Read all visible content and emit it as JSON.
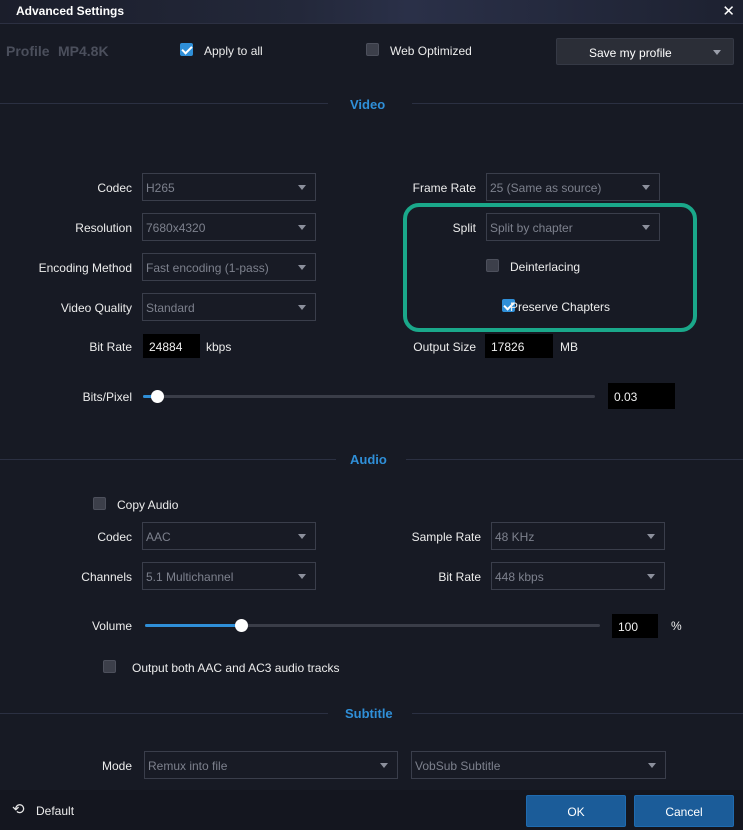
{
  "window": {
    "title": "Advanced Settings",
    "close_icon": "close-icon"
  },
  "profile": {
    "prefix": "Profile",
    "name": "MP4.8K",
    "apply_to_all": {
      "label": "Apply to all",
      "checked": true
    },
    "web_optimized": {
      "label": "Web Optimized",
      "checked": false
    },
    "save_button": "Save my profile"
  },
  "video": {
    "section_title": "Video",
    "codec": {
      "label": "Codec",
      "value": "H265"
    },
    "resolution": {
      "label": "Resolution",
      "value": "7680x4320"
    },
    "encoding_method": {
      "label": "Encoding Method",
      "value": "Fast encoding (1-pass)"
    },
    "video_quality": {
      "label": "Video Quality",
      "value": "Standard"
    },
    "bit_rate": {
      "label": "Bit Rate",
      "value": "24884",
      "unit": "kbps"
    },
    "frame_rate": {
      "label": "Frame Rate",
      "value": "25 (Same as source)"
    },
    "split": {
      "label": "Split",
      "value": "Split by chapter"
    },
    "deinterlacing": {
      "label": "Deinterlacing",
      "checked": false
    },
    "preserve_chapters": {
      "label": "Preserve Chapters",
      "checked": true
    },
    "output_size": {
      "label": "Output Size",
      "value": "17826",
      "unit": "MB"
    },
    "bits_pixel": {
      "label": "Bits/Pixel",
      "value": "0.03",
      "level": 0.03
    }
  },
  "audio": {
    "section_title": "Audio",
    "copy_audio": {
      "label": "Copy Audio",
      "checked": false
    },
    "codec": {
      "label": "Codec",
      "value": "AAC"
    },
    "channels": {
      "label": "Channels",
      "value": "5.1 Multichannel"
    },
    "sample_rate": {
      "label": "Sample Rate",
      "value": "48 KHz"
    },
    "bit_rate": {
      "label": "Bit Rate",
      "value": "448 kbps"
    },
    "volume": {
      "label": "Volume",
      "value": "100",
      "unit": "%",
      "level": 0.21
    },
    "output_both": {
      "label": "Output both AAC and AC3 audio tracks",
      "checked": false
    }
  },
  "subtitle": {
    "section_title": "Subtitle",
    "mode": {
      "label": "Mode",
      "value": "Remux into file"
    },
    "format": {
      "value": "VobSub Subtitle"
    }
  },
  "footer": {
    "default_label": "Default",
    "default_icon": "reset-icon",
    "ok_label": "OK",
    "cancel_label": "Cancel"
  },
  "colors": {
    "accent": "#2f8fd8",
    "highlight": "#1aa88a",
    "background": "#171a24"
  }
}
